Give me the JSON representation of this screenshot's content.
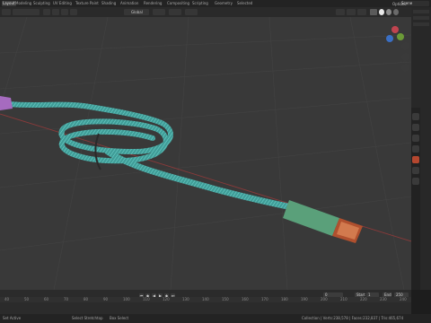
{
  "topbar": {
    "tabs": [
      "Layout",
      "Modeling",
      "Sculpting",
      "UV Editing",
      "Texture Paint",
      "Shading",
      "Animation",
      "Rendering",
      "Compositing",
      "Scripting",
      "Geometry",
      "Selected"
    ],
    "scene_label": "Scene"
  },
  "header": {
    "transform_orientation": "Global",
    "options_label": "Options"
  },
  "timeline": {
    "ticks": [
      "40",
      "50",
      "60",
      "70",
      "80",
      "90",
      "100",
      "110",
      "120",
      "130",
      "140",
      "150",
      "160",
      "170",
      "180",
      "190",
      "200",
      "210",
      "220",
      "230",
      "240"
    ],
    "current_frame": "0",
    "start_label": "Start",
    "start_value": "1",
    "end_label": "End",
    "end_value": "250"
  },
  "status": {
    "left_mode": "Set Active",
    "select_label": "Select Stretchtop",
    "box_select_label": "Box Select",
    "right_info": "Collection | Verts:238,578 | Faces:232,837 | Tris:465,674"
  },
  "colors": {
    "cable": "#4fb3ad",
    "connector": "#5aa07a",
    "tip": "#b0502e",
    "plug_left": "#a66bbf",
    "grid_red_axis": "#8a3a3a"
  }
}
